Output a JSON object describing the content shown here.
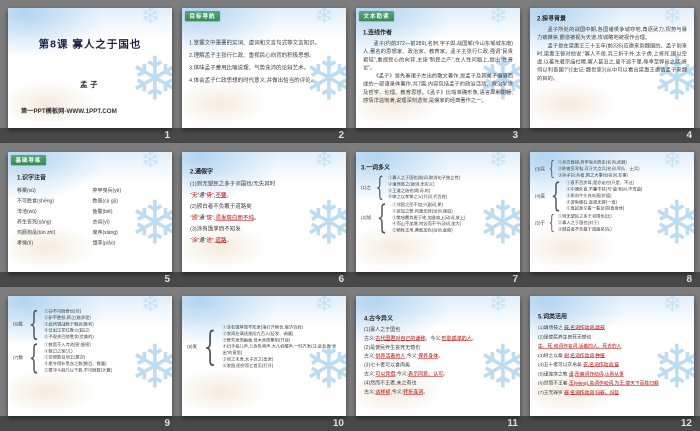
{
  "page": {
    "background": "#7d7d7d",
    "band_color": "#484848",
    "badge_green": "#44995f",
    "highlight_red": "#c00000",
    "snowflake_blue": "#a8cfe8",
    "snowflake_icon": "❄"
  },
  "slides": [
    {
      "number": "1",
      "type": "title",
      "title": "第8课  寡人之于国也",
      "subtitle": "孟子",
      "footer": "第一PPT模板网-WWW.1PPT.COM"
    },
    {
      "number": "2",
      "type": "list",
      "badge": "目标导航",
      "lines": [
        "1.掌握文中重要的实词、虚词和文言句式等文言知识。",
        "2.理解孟子主张行仁政、重视民心向背的积极思想。",
        "3.体味孟子善用比喻说理、气势充沛的论辩艺术。",
        "4.体会孟子仁政思想的时代意义,并做出恰当的评论。"
      ]
    },
    {
      "number": "3",
      "type": "prose",
      "badge": "文本助读",
      "heading": "1.连线作者",
      "paragraphs": [
        "孟子(约前372—前289),名轲,字子舆,战国邹(今山东邹城东南)人,著名的思想家、政治家、教育家。孟子主张行仁政,强调“民贵君轻”,重视民心的向背,主张“制民之产”,在人性问题上,提出“性善论”。",
        "《孟子》是先秦诸子杰出的散文著作,是孟子及其弟子编纂而成的一部语录体著作,共7篇,内容包括孟子的政治活动、政治学说及哲学、伦理、教育思想。《孟子》比喻准确形象,语言犀利酣畅,感情洋溢饱满,说理深刻透彻,是儒家的经典著作之一。"
      ]
    },
    {
      "number": "4",
      "type": "prose",
      "heading": "2.探寻背景",
      "paragraphs": [
        "孟子所处的战国中期,各国诸侯争城夺地,角逐武力,权势与暴力被推崇,霸道被视为天道,攻城略地被视作合理。",
        "孟子是在梁惠王三十五年(前335)应邀来到魏国的。孟子到来时,梁惠王曾对他说:“寡人不佞,兵三折于外,太子虏,上将死,国以空虚,以羞先君宗庙社稷,寡人甚丑之,叟不远千里,辱幸至弊邑之廷,将何以利吾国?”(《史记·魏世家》)从中可以看出梁惠王邀请孟子来魏的目的。"
      ]
    },
    {
      "number": "5",
      "type": "pinyin",
      "badge": "基础导练",
      "heading": "1.识字注音",
      "columns": [
        [
          "移粟(sù)",
          "不可胜食(shēng)",
          "洿池(wū)",
          "养生丧死(sàng)",
          "鸡豚狗彘(tún zhì)",
          "孝悌(tì)"
        ],
        [
          "弃甲曳兵(yè)",
          "数罟(cù gǔ)",
          "鱼鳖(biē)",
          "衣帛(yì)",
          "庠序(xiáng)",
          "饿莩(piǎo)"
        ]
      ]
    },
    {
      "number": "6",
      "type": "rich",
      "heading": "2.通假字",
      "lines": [
        {
          "text": "(1)则无望民之多于邻国也/无失其时"
        },
        {
          "segs": [
            {
              "t": "“",
              "s": "b"
            },
            {
              "t": "无",
              "s": "r"
            },
            {
              "t": "”通“",
              "s": "b"
            },
            {
              "t": "毋",
              "s": "r"
            },
            {
              "t": "”,",
              "s": "b"
            },
            {
              "t": "不要",
              "s": "u"
            },
            {
              "t": "。",
              "s": "b"
            }
          ]
        },
        {
          "text": "(2)颁白者不负戴于道路矣"
        },
        {
          "segs": [
            {
              "t": "“",
              "s": "b"
            },
            {
              "t": "颁",
              "s": "r"
            },
            {
              "t": "”通“",
              "s": "b"
            },
            {
              "t": "斑",
              "s": "r"
            },
            {
              "t": "”,",
              "s": "b"
            },
            {
              "t": "须发斑白而不纯",
              "s": "u"
            },
            {
              "t": "。",
              "s": "b"
            }
          ]
        },
        {
          "text": "(3)涂有饿莩而不知发"
        },
        {
          "segs": [
            {
              "t": "“",
              "s": "b"
            },
            {
              "t": "涂",
              "s": "r"
            },
            {
              "t": "”通“",
              "s": "b"
            },
            {
              "t": "途",
              "s": "r"
            },
            {
              "t": "”,",
              "s": "b"
            },
            {
              "t": "道路",
              "s": "u"
            },
            {
              "t": "。",
              "s": "b"
            }
          ]
        }
      ]
    },
    {
      "number": "7",
      "type": "poly",
      "heading": "3.一词多义",
      "groups": [
        {
          "label": "(1)之",
          "items": [
            "①寡人之于国也(助词,取消句子独立性)",
            "②填然鼓之(助词,无实义)",
            "③王道之始也(助词,的)",
            "④申之以孝悌之义(代词,代百姓)"
          ]
        },
        {
          "label": "(2)加",
          "items": [
            "①邻国之民不加少(副词,更)",
            "②欲加之罪,何患无辞(动词,强加)",
            "③樊哙覆其盾于地,加彘肩上(动词,放上)",
            "④而山不加增,何苦而不平(动词,加大)",
            "⑤牺牲玉帛,弗敢加也(动词,虚报)"
          ]
        }
      ]
    },
    {
      "number": "8",
      "type": "poly",
      "heading": "",
      "groups": [
        {
          "label": "(3)兵",
          "items": [
            "①兵刃既接,弃甲曳兵而走(名词,武器)",
            "②昨夜见军帖,可汗大点兵(名词,军队、士兵)",
            "③孙子曰:兵者,国之大事也(名词,军事)"
          ]
        },
        {
          "label": "(4)直",
          "items": [
            "①直不百步耳,是亦走也(只是、不过)",
            "②中通外直,不蔓不枝(与“曲”相对,不弯曲)",
            "③系向牛头充炭直(价值)",
            "④游鱼细石,直视无碍(一直)",
            "⑤直起身又看一看豆(挺直身体)"
          ]
        },
        {
          "label": "(5)于",
          "items": [
            "①则无望民之多于邻国也(比)",
            "②寡人之于国也(对于)",
            "③颁白者不负戴于道路矣(在)"
          ]
        }
      ]
    },
    {
      "number": "9",
      "type": "poly",
      "heading": "",
      "groups": [
        {
          "label": "(6)胜",
          "items": [
            "①谷不可胜食也(尽)",
            "②驴不胜怒,蹄之(能承受)",
            "③此所谓战胜于朝廷(胜利)",
            "④日出江花红胜火(超过)",
            "⑤予观夫巴陵胜状(优美的)"
          ]
        },
        {
          "label": "(7)数",
          "items": [
            "①数罟不入洿池(密,细密)",
            "②数口之家(几)",
            "③范增数目项王(屡次)",
            "④愿令得补黑衣之数(数目、数量)",
            "⑤蒙冲斗舰乃以千数,不可胜数(计算)"
          ]
        }
      ]
    },
    {
      "number": "10",
      "type": "poly",
      "heading": "",
      "groups": [
        {
          "label": "(8)发",
          "items": [
            "①涂有饿莩而不知发(指打开粮仓,赈济百姓)",
            "②发闾左谪戍渔阳九百人(征发、调遣)",
            "③野芳发而幽香,佳木秀而繁阴(开放)",
            "④妇手拍儿声,儿含乳啼声,大儿初醒声,一时齐发(注:此处为“发出”的意思)",
            "⑤顷之未发,太子迟之(出发)",
            "⑥发图,图穷而匕首见(打开)"
          ]
        }
      ]
    },
    {
      "number": "11",
      "type": "rich",
      "heading": "4.古今异义",
      "lines": [
        {
          "text": "(1)寡人之于国也"
        },
        {
          "segs": [
            {
              "t": "古义:",
              "s": "b"
            },
            {
              "t": "古代国君对自己的谦称",
              "s": "u"
            },
            {
              "t": "。今义:",
              "s": "b"
            },
            {
              "t": "形影孤单的人",
              "s": "u"
            },
            {
              "t": "。",
              "s": "b"
            }
          ]
        },
        {
          "text": "(2)是使民养生丧死无憾也"
        },
        {
          "segs": [
            {
              "t": "古义:",
              "s": "b"
            },
            {
              "t": "供养活着的人",
              "s": "u"
            },
            {
              "t": ",今义:",
              "s": "b"
            },
            {
              "t": "保养身体",
              "s": "u"
            },
            {
              "t": "。",
              "s": "b"
            }
          ]
        },
        {
          "text": "(3)七十者可以食肉矣"
        },
        {
          "segs": [
            {
              "t": "古义:",
              "s": "b"
            },
            {
              "t": "可以凭借",
              "s": "u"
            },
            {
              "t": ",今义:",
              "s": "b"
            },
            {
              "t": "表示同意、认可",
              "s": "u"
            },
            {
              "t": "。",
              "s": "b"
            }
          ]
        },
        {
          "text": "(4)然而不王者,未之有也"
        },
        {
          "segs": [
            {
              "t": "古义:",
              "s": "b"
            },
            {
              "t": "这样却",
              "s": "u"
            },
            {
              "t": ",今义:",
              "s": "b"
            },
            {
              "t": "转折连词",
              "s": "u"
            },
            {
              "t": "。",
              "s": "b"
            }
          ]
        }
      ]
    },
    {
      "number": "12",
      "type": "rich",
      "heading": "5.词类活用",
      "lines": [
        {
          "segs": [
            {
              "t": "(1)填然鼓之  ",
              "s": "b"
            },
            {
              "t": "鼓,名词作动词,敲鼓",
              "s": "u"
            }
          ]
        },
        {
          "segs": [
            {
              "t": "(2)是使民养生丧死无憾也",
              "s": "b"
            }
          ]
        },
        {
          "segs": [
            {
              "t": "生、死,动词作名词,活着的人、死去的人",
              "s": "u"
            }
          ]
        },
        {
          "segs": [
            {
              "t": "(3)树之以桑  ",
              "s": "b"
            },
            {
              "t": "树,名词作动词,种植",
              "s": "u"
            }
          ]
        },
        {
          "segs": [
            {
              "t": "(4)五十者可以衣帛矣  ",
              "s": "b"
            },
            {
              "t": "衣,名词作动词,穿",
              "s": "u"
            }
          ]
        },
        {
          "segs": [
            {
              "t": "(5)谨庠序之教  ",
              "s": "b"
            },
            {
              "t": "谨,形容词作动词,认真从事",
              "s": "u"
            }
          ]
        },
        {
          "segs": [
            {
              "t": "(6)然而不王者  ",
              "s": "b"
            },
            {
              "t": "王(wàng),名词作动词,为王,使天下百姓归顺",
              "s": "u"
            }
          ]
        },
        {
          "segs": [
            {
              "t": "(7)王无罪岁  ",
              "s": "b"
            },
            {
              "t": "罪,名词作动词,归罪、归咎",
              "s": "u"
            }
          ]
        }
      ]
    }
  ]
}
